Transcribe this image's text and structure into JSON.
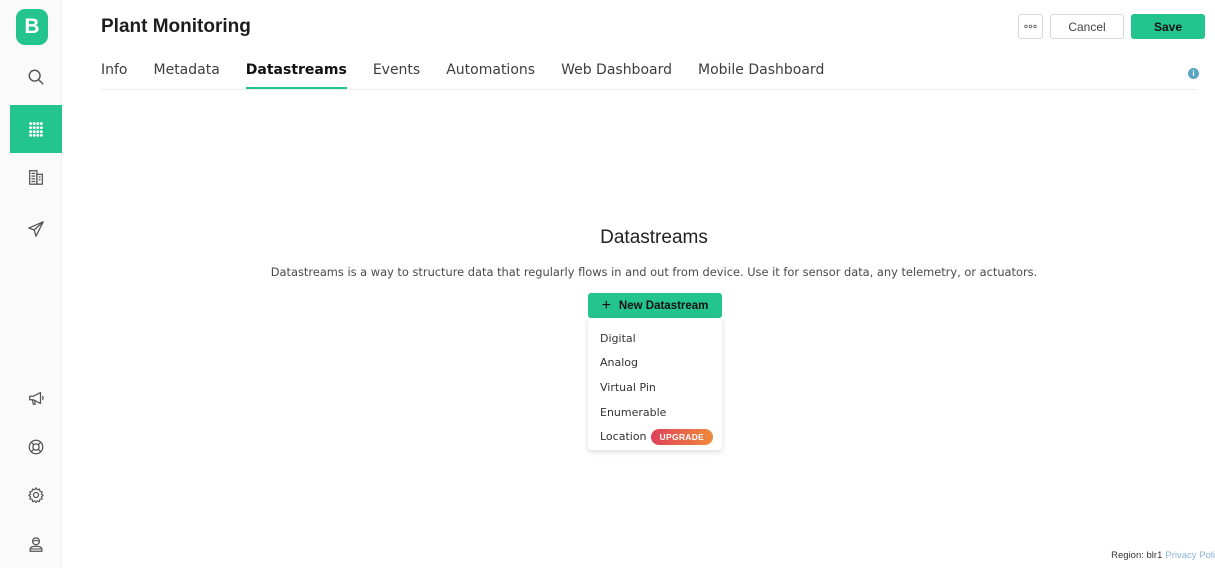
{
  "app": {
    "logo_letter": "B"
  },
  "sidebar": {
    "items": [
      {
        "icon": "search-icon",
        "active": false
      },
      {
        "icon": "grid-icon",
        "active": true
      },
      {
        "icon": "building-icon",
        "active": false
      },
      {
        "icon": "send-icon",
        "active": false
      },
      {
        "icon": "megaphone-icon",
        "active": false
      },
      {
        "icon": "lifebuoy-icon",
        "active": false
      },
      {
        "icon": "gear-icon",
        "active": false
      },
      {
        "icon": "user-icon",
        "active": false
      }
    ]
  },
  "header": {
    "title": "Plant Monitoring",
    "more_icon": "more-icon",
    "cancel_label": "Cancel",
    "save_label": "Save"
  },
  "tabs": [
    {
      "label": "Info",
      "active": false
    },
    {
      "label": "Metadata",
      "active": false
    },
    {
      "label": "Datastreams",
      "active": true
    },
    {
      "label": "Events",
      "active": false
    },
    {
      "label": "Automations",
      "active": false
    },
    {
      "label": "Web Dashboard",
      "active": false
    },
    {
      "label": "Mobile Dashboard",
      "active": false
    }
  ],
  "empty_state": {
    "title": "Datastreams",
    "description": "Datastreams is a way to structure data that regularly flows in and out from device. Use it for sensor data, any telemetry, or actuators.",
    "new_button_label": "New Datastream"
  },
  "dropdown": {
    "items": [
      "Digital",
      "Analog",
      "Virtual Pin",
      "Enumerable",
      "Location"
    ],
    "upgrade_badge": "UPGRADE"
  },
  "footer": {
    "region": "Region: blr1",
    "privacy": "Privacy Poli"
  },
  "colors": {
    "accent": "#23c48e",
    "upgrade_start": "#e0405a",
    "upgrade_end": "#ee8b3a"
  }
}
